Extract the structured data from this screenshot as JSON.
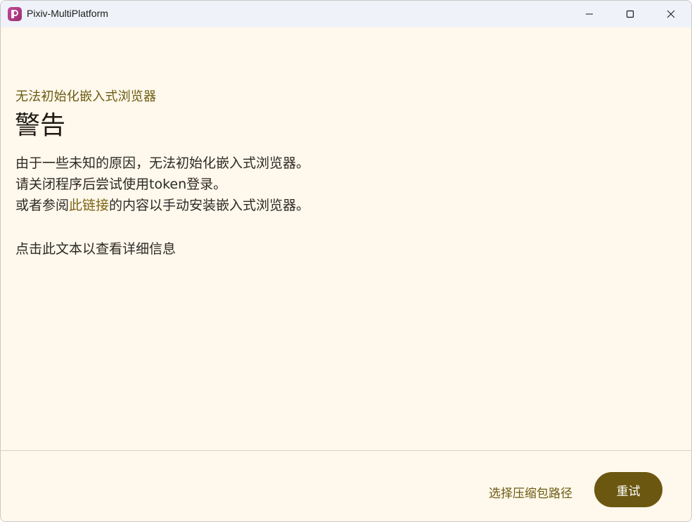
{
  "window": {
    "title": "Pixiv-MultiPlatform",
    "app_icon": "pixiv-logo-icon",
    "controls": [
      "minimize-icon",
      "maximize-icon",
      "close-icon"
    ]
  },
  "dialog": {
    "subtitle": "无法初始化嵌入式浏览器",
    "title": "警告",
    "line1": "由于一些未知的原因，无法初始化嵌入式浏览器。",
    "line2": "请关闭程序后尝试使用token登录。",
    "line3_prefix": "或者参阅",
    "line3_link": "此链接",
    "line3_suffix": "的内容以手动安装嵌入式浏览器。",
    "details_link": "点击此文本以查看详细信息"
  },
  "footer": {
    "select_path_label": "选择压缩包路径",
    "retry_label": "重试"
  },
  "colors": {
    "accent": "#6b5710",
    "background": "#fff8ec",
    "titlebar": "#eff2f8"
  }
}
